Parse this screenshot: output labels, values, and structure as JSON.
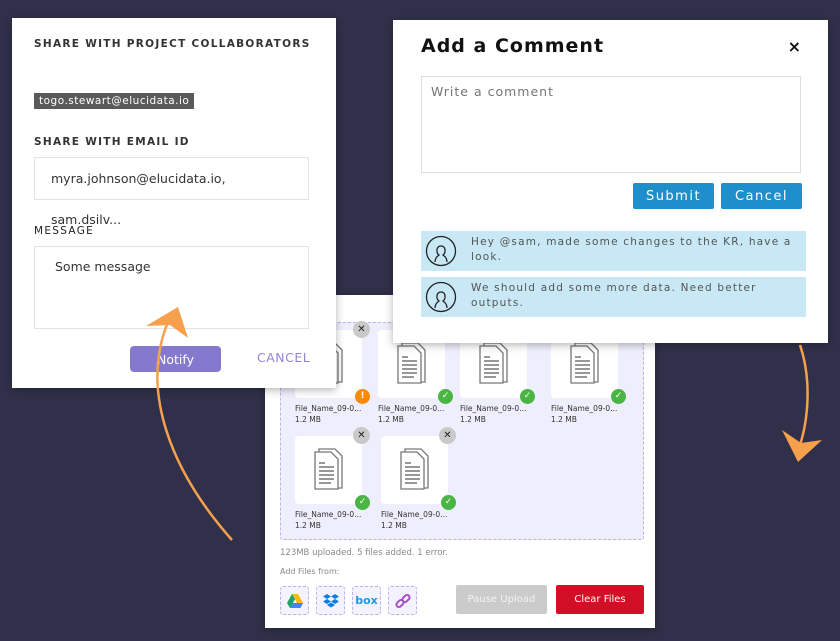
{
  "share": {
    "collab_label": "SHARE WITH PROJECT COLLABORATORS",
    "collaborator": "togo.stewart@elucidata.io",
    "email_label": "SHARE WITH EMAIL ID",
    "email_value": "myra.johnson@elucidata.io, sam.dsilv...",
    "message_label": "MESSAGE",
    "message_value": "Some message",
    "notify": "Notify",
    "cancel": "CANCEL"
  },
  "comment": {
    "title": "Add a Comment",
    "close": "×",
    "placeholder": "Write a comment",
    "submit": "Submit",
    "cancel": "Cancel",
    "comments": [
      {
        "text": "Hey @sam, made some changes to the KR, have a look."
      },
      {
        "text": "We should add some more data. Need better outputs."
      }
    ]
  },
  "upload": {
    "files": [
      {
        "name": "File_Name_09-0...",
        "size": "1.2 MB",
        "status": "error"
      },
      {
        "name": "File_Name_09-0...",
        "size": "1.2 MB",
        "status": "done"
      },
      {
        "name": "File_Name_09-0...",
        "size": "1.2 MB",
        "status": "done"
      },
      {
        "name": "File_Name_09-0...",
        "size": "1.2 MB",
        "status": "done"
      },
      {
        "name": "File_Name_09-0...",
        "size": "1.2 MB",
        "status": "done"
      },
      {
        "name": "File_Name_09-0...",
        "size": "1.2 MB",
        "status": "done"
      }
    ],
    "summary": "123MB uploaded. 5 files added. 1 error.",
    "add_from": "Add Files from:",
    "sources": [
      "google-drive",
      "dropbox",
      "box",
      "link"
    ],
    "box_label": "box",
    "pause": "Pause Upload",
    "clear": "Clear Files"
  },
  "colors": {
    "accent_purple": "#8579cf",
    "primary_blue": "#1e8fcb",
    "danger": "#d20f26",
    "success": "#4bb543",
    "warning": "#f68a0a",
    "arrow": "#f6a04d",
    "background": "#30304a"
  }
}
